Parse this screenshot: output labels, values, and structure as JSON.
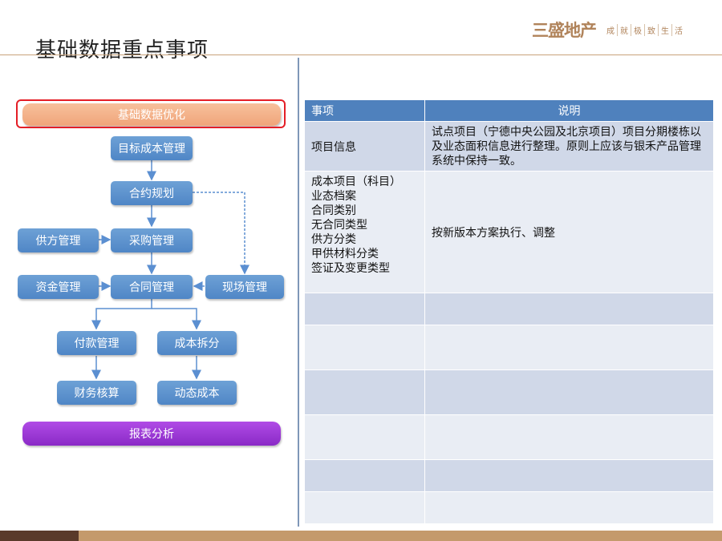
{
  "header": {
    "title": "基础数据重点事项",
    "logo_mark": "三盛地产",
    "logo_slogan": [
      "成",
      "就",
      "极",
      "致",
      "生",
      "活"
    ]
  },
  "flow": {
    "top_banner": "基础数据优化",
    "target_cost": "目标成本管理",
    "contract_plan": "合约规划",
    "supplier": "供方管理",
    "procurement": "采购管理",
    "funds": "资金管理",
    "contract": "合同管理",
    "site": "现场管理",
    "payment": "付款管理",
    "cost_split": "成本拆分",
    "accounting": "财务核算",
    "dynamic_cost": "动态成本",
    "report": "报表分析"
  },
  "table": {
    "headers": [
      "事项",
      "说明"
    ],
    "rows": [
      {
        "item": [
          "项目信息"
        ],
        "desc": "试点项目（宁德中央公园及北京项目）项目分期楼栋以及业态面积信息进行整理。原则上应该与银禾产品管理系统中保持一致。"
      },
      {
        "item": [
          "成本项目（科目）",
          "业态档案",
          "合同类别",
          "无合同类型",
          "供方分类",
          "甲供材料分类",
          "签证及变更类型"
        ],
        "desc": "按新版本方案执行、调整"
      },
      {
        "item": [],
        "desc": ""
      },
      {
        "item": [],
        "desc": ""
      },
      {
        "item": [],
        "desc": ""
      },
      {
        "item": [],
        "desc": ""
      },
      {
        "item": [],
        "desc": ""
      },
      {
        "item": [],
        "desc": ""
      }
    ]
  }
}
